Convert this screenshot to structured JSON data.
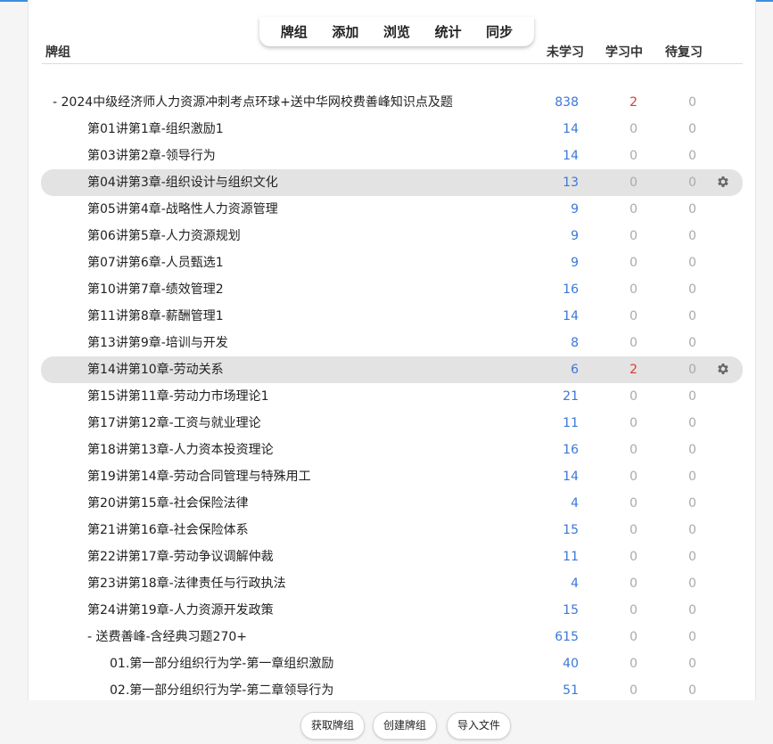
{
  "nav": [
    "牌组",
    "添加",
    "浏览",
    "统计",
    "同步"
  ],
  "header": {
    "deck": "牌组",
    "new": "未学习",
    "learn": "学习中",
    "due": "待复习"
  },
  "rows": [
    {
      "name": "-  2024中级经济师人力资源冲刺考点环球+送中华网校费善峰知识点及题",
      "new": "838",
      "learn": "2",
      "due": "0",
      "depth": 0,
      "learn_red": true,
      "gear": false
    },
    {
      "name": "第01讲第1章-组织激励1",
      "new": "14",
      "learn": "0",
      "due": "0",
      "depth": 1
    },
    {
      "name": "第03讲第2章-领导行为",
      "new": "14",
      "learn": "0",
      "due": "0",
      "depth": 1
    },
    {
      "name": "第04讲第3章-组织设计与组织文化",
      "new": "13",
      "learn": "0",
      "due": "0",
      "depth": 1,
      "highlight": true,
      "gear": true
    },
    {
      "name": "第05讲第4章-战略性人力资源管理",
      "new": "9",
      "learn": "0",
      "due": "0",
      "depth": 1
    },
    {
      "name": "第06讲第5章-人力资源规划",
      "new": "9",
      "learn": "0",
      "due": "0",
      "depth": 1
    },
    {
      "name": "第07讲第6章-人员甄选1",
      "new": "9",
      "learn": "0",
      "due": "0",
      "depth": 1
    },
    {
      "name": "第10讲第7章-绩效管理2",
      "new": "16",
      "learn": "0",
      "due": "0",
      "depth": 1
    },
    {
      "name": "第11讲第8章-薪酬管理1",
      "new": "14",
      "learn": "0",
      "due": "0",
      "depth": 1
    },
    {
      "name": "第13讲第9章-培训与开发",
      "new": "8",
      "learn": "0",
      "due": "0",
      "depth": 1
    },
    {
      "name": "第14讲第10章-劳动关系",
      "new": "6",
      "learn": "2",
      "due": "0",
      "depth": 1,
      "highlight": true,
      "gear": true,
      "learn_red": true
    },
    {
      "name": "第15讲第11章-劳动力市场理论1",
      "new": "21",
      "learn": "0",
      "due": "0",
      "depth": 1
    },
    {
      "name": "第17讲第12章-工资与就业理论",
      "new": "11",
      "learn": "0",
      "due": "0",
      "depth": 1
    },
    {
      "name": "第18讲第13章-人力资本投资理论",
      "new": "16",
      "learn": "0",
      "due": "0",
      "depth": 1
    },
    {
      "name": "第19讲第14章-劳动合同管理与特殊用工",
      "new": "14",
      "learn": "0",
      "due": "0",
      "depth": 1
    },
    {
      "name": "第20讲第15章-社会保险法律",
      "new": "4",
      "learn": "0",
      "due": "0",
      "depth": 1
    },
    {
      "name": "第21讲第16章-社会保险体系",
      "new": "15",
      "learn": "0",
      "due": "0",
      "depth": 1
    },
    {
      "name": "第22讲第17章-劳动争议调解仲裁",
      "new": "11",
      "learn": "0",
      "due": "0",
      "depth": 1
    },
    {
      "name": "第23讲第18章-法律责任与行政执法",
      "new": "4",
      "learn": "0",
      "due": "0",
      "depth": 1
    },
    {
      "name": "第24讲第19章-人力资源开发政策",
      "new": "15",
      "learn": "0",
      "due": "0",
      "depth": 1
    },
    {
      "name": "-  送费善峰-含经典习题270+",
      "new": "615",
      "learn": "0",
      "due": "0",
      "depth": 1
    },
    {
      "name": "01.第一部分组织行为学-第一章组织激励",
      "new": "40",
      "learn": "0",
      "due": "0",
      "depth": 2
    },
    {
      "name": "02.第一部分组织行为学-第二章领导行为",
      "new": "51",
      "learn": "0",
      "due": "0",
      "depth": 2
    }
  ],
  "bottom": {
    "get_shared": "获取牌组",
    "create_deck": "创建牌组",
    "import_file": "导入文件"
  },
  "colors": {
    "new": "#3a78d8",
    "learn_active": "#d93a3a",
    "muted": "#aaaaaa",
    "accent": "#3d8fe0"
  },
  "icons": {
    "row_options": "gear-icon"
  }
}
